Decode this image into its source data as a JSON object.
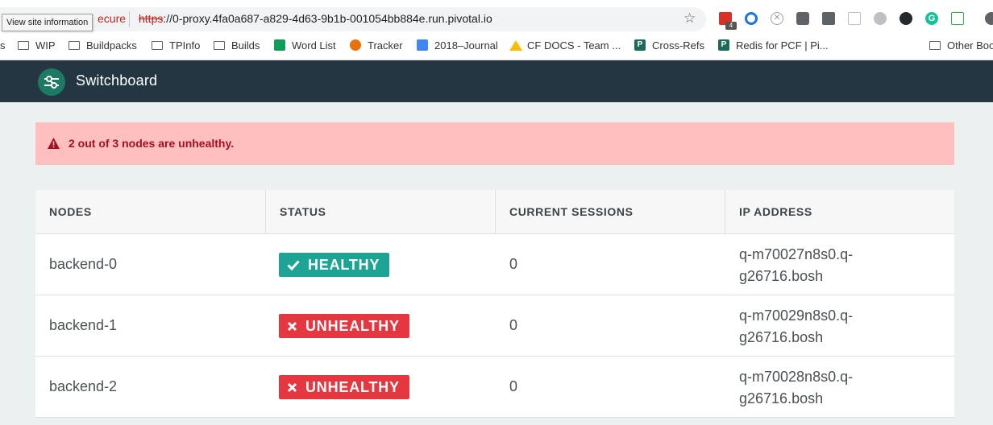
{
  "browser": {
    "tooltip": "View site information",
    "security_text": "ecure",
    "url_scheme": "https",
    "url_rest": "://0-proxy.4fa0a687-a829-4d63-9b1b-001054bb884e.run.pivotal.io",
    "extension_badge": "4",
    "bookmarks": [
      {
        "label": "s",
        "icon": "folder-icon"
      },
      {
        "label": "WIP",
        "icon": "folder-icon"
      },
      {
        "label": "Buildpacks",
        "icon": "folder-icon"
      },
      {
        "label": "TPInfo",
        "icon": "folder-icon"
      },
      {
        "label": "Builds",
        "icon": "folder-icon"
      },
      {
        "label": "Word List",
        "icon": "sheets-icon"
      },
      {
        "label": "Tracker",
        "icon": "tracker-icon"
      },
      {
        "label": "2018–Journal",
        "icon": "docs-icon"
      },
      {
        "label": "CF DOCS - Team ...",
        "icon": "drive-icon"
      },
      {
        "label": "Cross-Refs",
        "icon": "p-icon"
      },
      {
        "label": "Redis for PCF | Pi...",
        "icon": "p-icon"
      },
      {
        "label": "Other Boo",
        "icon": "folder-icon"
      }
    ]
  },
  "app": {
    "title": "Switchboard",
    "accent_color": "#243641"
  },
  "alert": {
    "message": "2 out of 3 nodes are unhealthy.",
    "icon": "warning-icon",
    "color": "#ffbfbf"
  },
  "table": {
    "headers": [
      "NODES",
      "STATUS",
      "CURRENT SESSIONS",
      "IP ADDRESS"
    ],
    "rows": [
      {
        "node": "backend-0",
        "status": "HEALTHY",
        "status_icon": "check-icon",
        "sessions": "0",
        "ip_line1": "q-m70027n8s0.q-",
        "ip_line2": "g26716.bosh"
      },
      {
        "node": "backend-1",
        "status": "UNHEALTHY",
        "status_icon": "x-icon",
        "sessions": "0",
        "ip_line1": "q-m70029n8s0.q-",
        "ip_line2": "g26716.bosh"
      },
      {
        "node": "backend-2",
        "status": "UNHEALTHY",
        "status_icon": "x-icon",
        "sessions": "0",
        "ip_line1": "q-m70028n8s0.q-",
        "ip_line2": "g26716.bosh"
      }
    ],
    "healthy_color": "#1ea495",
    "unhealthy_color": "#e5373f"
  }
}
